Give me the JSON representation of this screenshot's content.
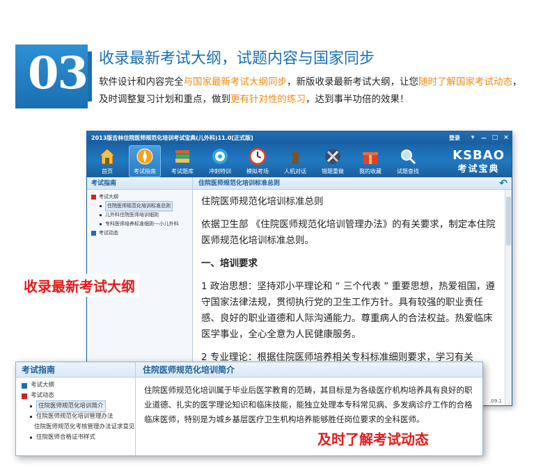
{
  "header": {
    "number": "03",
    "title": "收录最新考试大纲，试题内容与国家同步",
    "desc_parts": [
      {
        "text": "软件设计和内容完全",
        "hl": false
      },
      {
        "text": "与国家最新考试大纲同步",
        "hl": true
      },
      {
        "text": "，新版收录最新考试大纲，让您",
        "hl": false
      },
      {
        "text": "随时了解国家考试动态",
        "hl": true
      },
      {
        "text": "，及时调整复习计划和重点，做到",
        "hl": false
      },
      {
        "text": "更有针对性的练习",
        "hl": true
      },
      {
        "text": "，达到事半功倍的效果！",
        "hl": false
      }
    ]
  },
  "app": {
    "title": "2013版吉林住院医师规范化培训考试宝典(儿外科)11.0[正式版]",
    "login": "登录",
    "window_buttons": [
      "▾",
      "－",
      "□",
      "×"
    ],
    "toolbar": [
      {
        "label": "首页",
        "icon": "home-icon",
        "active": false
      },
      {
        "label": "考试指南",
        "icon": "compass-icon",
        "active": true
      },
      {
        "label": "考试题库",
        "icon": "books-icon",
        "active": false
      },
      {
        "label": "冲刺特训",
        "icon": "target-icon",
        "active": false
      },
      {
        "label": "模拟考场",
        "icon": "clock-icon",
        "active": false
      },
      {
        "label": "人机对话",
        "icon": "chess-icon",
        "active": false
      },
      {
        "label": "错题重做",
        "icon": "tools-icon",
        "active": false
      },
      {
        "label": "我的收藏",
        "icon": "gift-icon",
        "active": false
      },
      {
        "label": "试题查找",
        "icon": "magnifier-icon",
        "active": false
      }
    ],
    "brand": {
      "name": "KSBAO",
      "sub": "考试宝典"
    },
    "left": {
      "heading": "考试指南",
      "tree": [
        {
          "label": "考试大纲",
          "expanded": true,
          "children": [
            {
              "label": "住院医师规范化培训标准总则",
              "selected": true
            },
            {
              "label": "儿外科住院医师培训细则",
              "selected": false
            },
            {
              "label": "专科医师培养标准细则---小儿外科",
              "selected": false
            }
          ]
        },
        {
          "label": "考试动态",
          "expanded": false,
          "children": []
        }
      ]
    },
    "right": {
      "heading": "住院医师规范化培训标准总则",
      "paragraphs": [
        "住院医师规范化培训标准总则",
        "依据卫生部 《住院医师规范化培训管理办法》的有关要求，制定本住院医师规范化培训标准总则。",
        "一、培训要求",
        "1 政治思想：坚持邓小平理论和 “ 三个代表 ” 重要思想，热爱祖国，遵守国家法律法规，贯彻执行党的卫生工作方针。具有较强的职业责任感、良好的职业道德和人际沟通能力。尊重病人的合法权益。热爱临床医学事业，全心全意为人民健康服务。",
        "2 专业理论：根据住院医师培养相关专科标准细则要求，学习有关"
      ],
      "version": ".09.1"
    }
  },
  "labels": {
    "outline": "收录最新考试大纲",
    "news": "及时了解考试动态"
  },
  "zoom": {
    "left_heading": "考试指南",
    "tree": [
      {
        "label": "考试大纲",
        "expanded": false,
        "children": []
      },
      {
        "label": "考试动态",
        "expanded": true,
        "children": [
          {
            "label": "住院医师规范化培训简介",
            "selected": true
          },
          {
            "label": "住院医师规范化培训管理办法",
            "selected": false
          },
          {
            "label": "住院医师规范化考核管理办法证求意见",
            "selected": false
          },
          {
            "label": "住院医师合格证书样式",
            "selected": false
          }
        ]
      }
    ],
    "right_heading": "住院医师规范化培训简介",
    "text": "住院医师规范化培训属于毕业后医学教育的范畴，其目标是为各级医疗机构培养具有良好的职业道德、扎实的医学理论知识和临床技能，能独立处理本专科常见病、多发病诊疗工作的合格临床医师，特别是为城乡基层医疗卫生机构培养能够胜任岗位要求的全科医师。"
  }
}
